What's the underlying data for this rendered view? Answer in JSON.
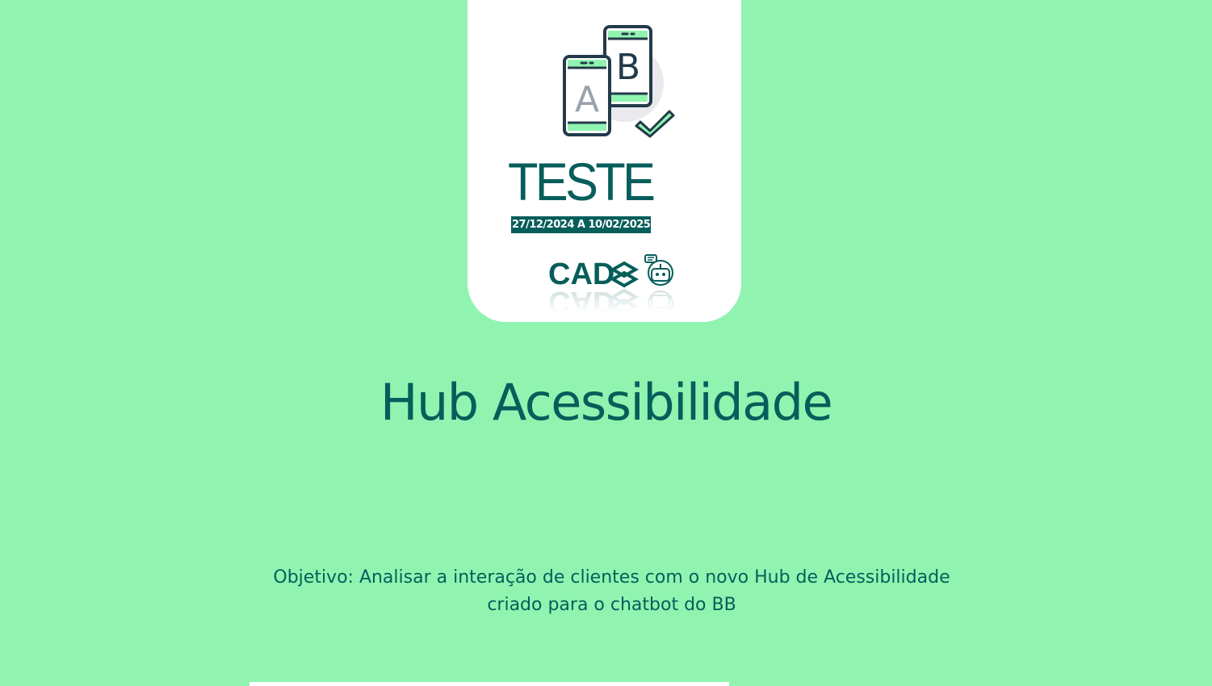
{
  "card": {
    "illustration_icon": "ab-test-phones-icon",
    "illustration_letters": [
      "A",
      "B"
    ],
    "title": "TESTE",
    "period": "27/12/2024 A 10/02/2025",
    "logos": {
      "cad_text": "CAD",
      "icons": [
        "cad-logo",
        "bb-logo-icon",
        "chatbot-robot-icon"
      ]
    }
  },
  "main": {
    "title": "Hub Acessibilidade",
    "objective_line1": "Objetivo: Analisar a interação de clientes com o novo Hub de Acessibilidade",
    "objective_line2": "criado para o chatbot do BB"
  },
  "colors": {
    "background": "#90f4b0",
    "card": "#ffffff",
    "primary": "#065e5b",
    "accent": "#90f4b0",
    "phone_outline": "#233a4a"
  }
}
